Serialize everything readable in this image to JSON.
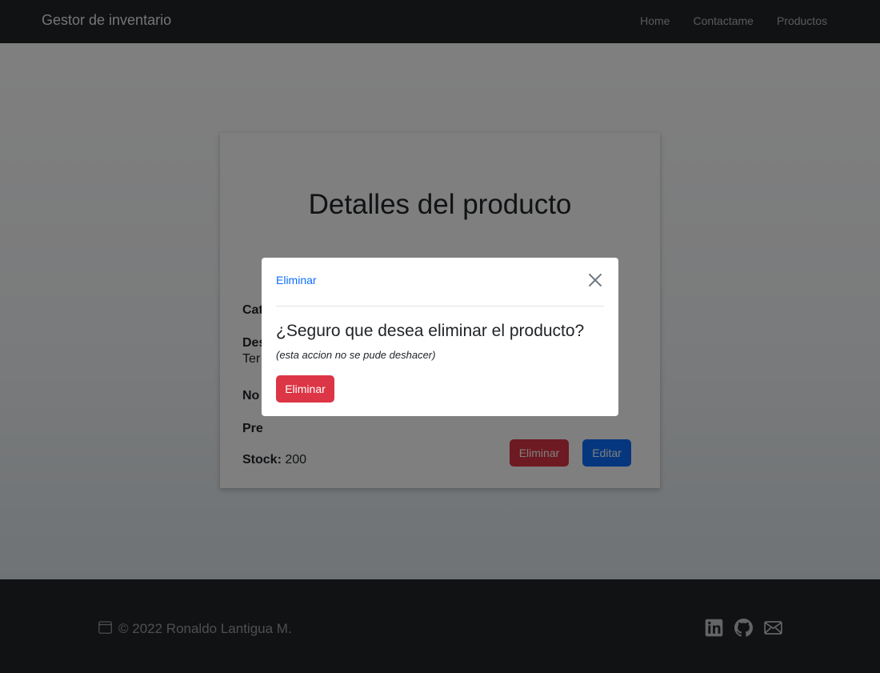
{
  "navbar": {
    "brand": "Gestor de inventario",
    "links": [
      "Home",
      "Contactame",
      "Productos"
    ]
  },
  "card": {
    "title": "Detalles del producto",
    "fields": [
      {
        "label": "Cat",
        "value": ""
      },
      {
        "label": "Des",
        "value": ""
      },
      {
        "label": "",
        "value": "Ter"
      },
      {
        "label": "No",
        "value": ""
      },
      {
        "label": "Pre",
        "value": ""
      },
      {
        "label": "Stock:",
        "value": "200"
      }
    ],
    "delete_label": "Eliminar",
    "edit_label": "Editar"
  },
  "footer": {
    "copyright": "© 2022 Ronaldo Lantigua M.",
    "icons": [
      "calendar-icon",
      "linkedin-icon",
      "github-icon",
      "envelope-icon"
    ]
  },
  "modal": {
    "title": "Eliminar",
    "question": "¿Seguro que desea eliminar el producto?",
    "note": "(esta accion no se pude deshacer)",
    "delete_label": "Eliminar",
    "close_icon": "close-icon"
  },
  "colors": {
    "navbar_bg": "#212529",
    "danger": "#dc3545",
    "primary": "#0d6efd",
    "backdrop": "rgba(0,0,0,0.5)"
  }
}
